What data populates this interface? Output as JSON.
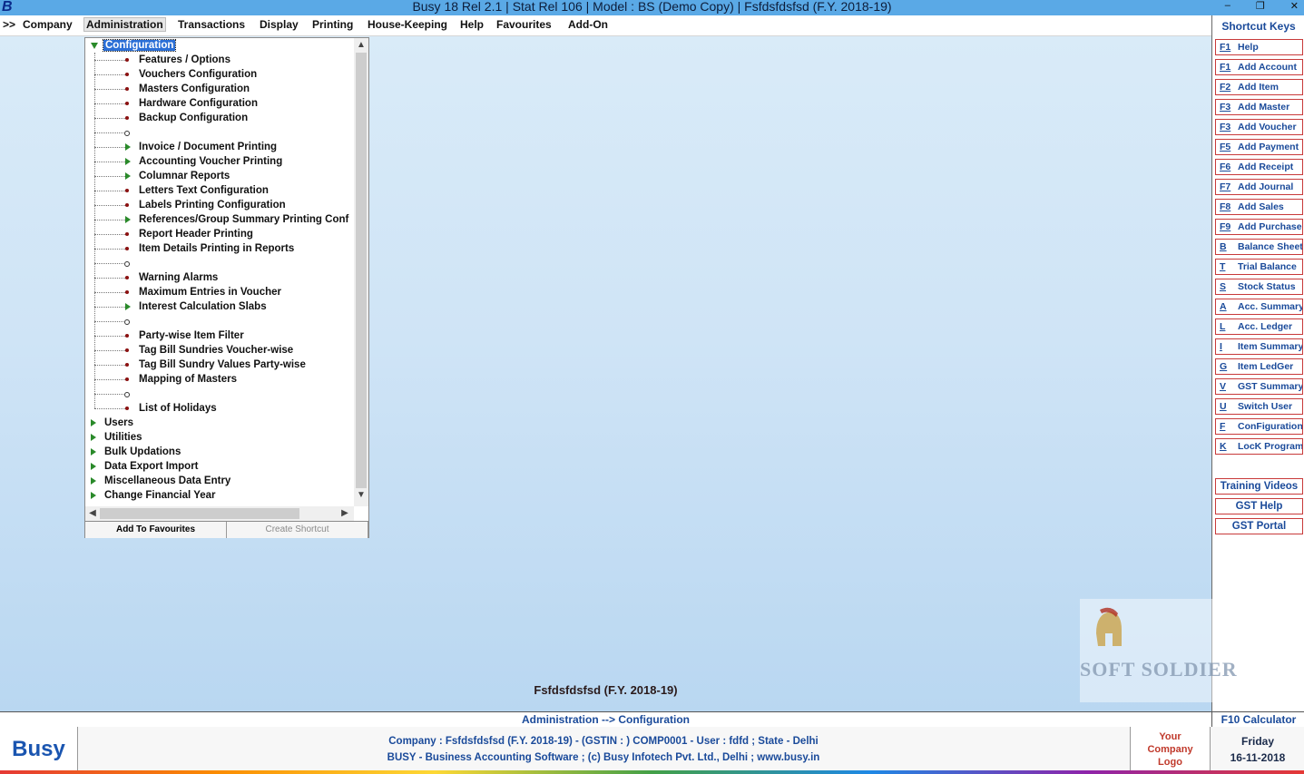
{
  "titlebar": {
    "app_icon": "B",
    "title": "Busy 18  Rel 2.1  |  Stat Rel 106  |  Model : BS (Demo Copy)  |  Fsfdsfdsfsd (F.Y. 2018-19)",
    "controls": [
      "–",
      "❐",
      "✕"
    ]
  },
  "menubar": {
    "prefix": ">>",
    "items": [
      "Company",
      "Administration",
      "Transactions",
      "Display",
      "Printing",
      "House-Keeping",
      "Help",
      "Favourites",
      "Add-On"
    ]
  },
  "tree": {
    "root": "Configuration",
    "children": [
      {
        "label": "Features / Options",
        "kind": "leaf"
      },
      {
        "label": "Vouchers Configuration",
        "kind": "leaf"
      },
      {
        "label": "Masters Configuration",
        "kind": "leaf"
      },
      {
        "label": "Hardware Configuration",
        "kind": "leaf"
      },
      {
        "label": "Backup Configuration",
        "kind": "leaf"
      },
      {
        "label": "",
        "kind": "separator"
      },
      {
        "label": "Invoice / Document Printing",
        "kind": "branch"
      },
      {
        "label": "Accounting Voucher Printing",
        "kind": "branch"
      },
      {
        "label": "Columnar Reports",
        "kind": "branch"
      },
      {
        "label": "Letters Text Configuration",
        "kind": "leaf"
      },
      {
        "label": "Labels Printing Configuration",
        "kind": "leaf"
      },
      {
        "label": "References/Group Summary Printing Conf",
        "kind": "branch"
      },
      {
        "label": "Report Header Printing",
        "kind": "leaf"
      },
      {
        "label": "Item Details Printing in Reports",
        "kind": "leaf"
      },
      {
        "label": "",
        "kind": "separator"
      },
      {
        "label": "Warning Alarms",
        "kind": "leaf"
      },
      {
        "label": "Maximum Entries in Voucher",
        "kind": "leaf"
      },
      {
        "label": "Interest Calculation Slabs",
        "kind": "branch"
      },
      {
        "label": "",
        "kind": "separator"
      },
      {
        "label": "Party-wise Item Filter",
        "kind": "leaf"
      },
      {
        "label": "Tag Bill Sundries Voucher-wise",
        "kind": "leaf"
      },
      {
        "label": "Tag Bill Sundry Values Party-wise",
        "kind": "leaf"
      },
      {
        "label": "Mapping of Masters",
        "kind": "leaf"
      },
      {
        "label": "",
        "kind": "separator"
      },
      {
        "label": "List of Holidays",
        "kind": "leaf"
      }
    ],
    "siblings": [
      "Users",
      "Utilities",
      "Bulk Updations",
      "Data Export Import",
      "Miscellaneous Data Entry",
      "Change Financial Year"
    ]
  },
  "panel_buttons": {
    "add_favourites": "Add To Favourites",
    "create_shortcut": "Create Shortcut"
  },
  "shortcuts": {
    "title": "Shortcut Keys",
    "keys": [
      {
        "key": "F1",
        "label": "Help"
      },
      {
        "key": "F1",
        "label": "Add Account"
      },
      {
        "key": "F2",
        "label": "Add Item"
      },
      {
        "key": "F3",
        "label": "Add Master"
      },
      {
        "key": "F3",
        "label": "Add Voucher"
      },
      {
        "key": "F5",
        "label": "Add Payment"
      },
      {
        "key": "F6",
        "label": "Add Receipt"
      },
      {
        "key": "F7",
        "label": "Add Journal"
      },
      {
        "key": "F8",
        "label": "Add Sales"
      },
      {
        "key": "F9",
        "label": "Add Purchase"
      },
      {
        "key": "B",
        "label": "Balance Sheet"
      },
      {
        "key": "T",
        "label": "Trial Balance"
      },
      {
        "key": "S",
        "label": "Stock Status"
      },
      {
        "key": "A",
        "label": "Acc. Summary"
      },
      {
        "key": "L",
        "label": "Acc. Ledger"
      },
      {
        "key": "I",
        "label": "Item Summary"
      },
      {
        "key": "G",
        "label": "Item LedGer"
      },
      {
        "key": "V",
        "label": "GST Summary"
      },
      {
        "key": "U",
        "label": "Switch User"
      },
      {
        "key": "F",
        "label": "ConFiguration"
      },
      {
        "key": "K",
        "label": "LocK Program"
      }
    ],
    "extra": [
      "Training Videos",
      "GST Help",
      "GST Portal"
    ]
  },
  "watermark": {
    "text": "SOFT SOLDIER"
  },
  "main": {
    "company_caption": "Fsfdsfdsfsd (F.Y. 2018-19)"
  },
  "status": {
    "path": "Administration --> Configuration",
    "calculator": "F10 Calculator"
  },
  "footer": {
    "logo": "Busy",
    "line1": "Company : Fsfdsfdsfsd (F.Y. 2018-19) - (GSTIN : ) COMP0001 - User : fdfd ; State - Delhi",
    "line2": "BUSY - Business Accounting Software  ;  (c) Busy Infotech Pvt. Ltd., Delhi  ;  www.busy.in",
    "company_logo": [
      "Your",
      "Company",
      "Logo"
    ],
    "day": "Friday",
    "date": "16-11-2018"
  }
}
